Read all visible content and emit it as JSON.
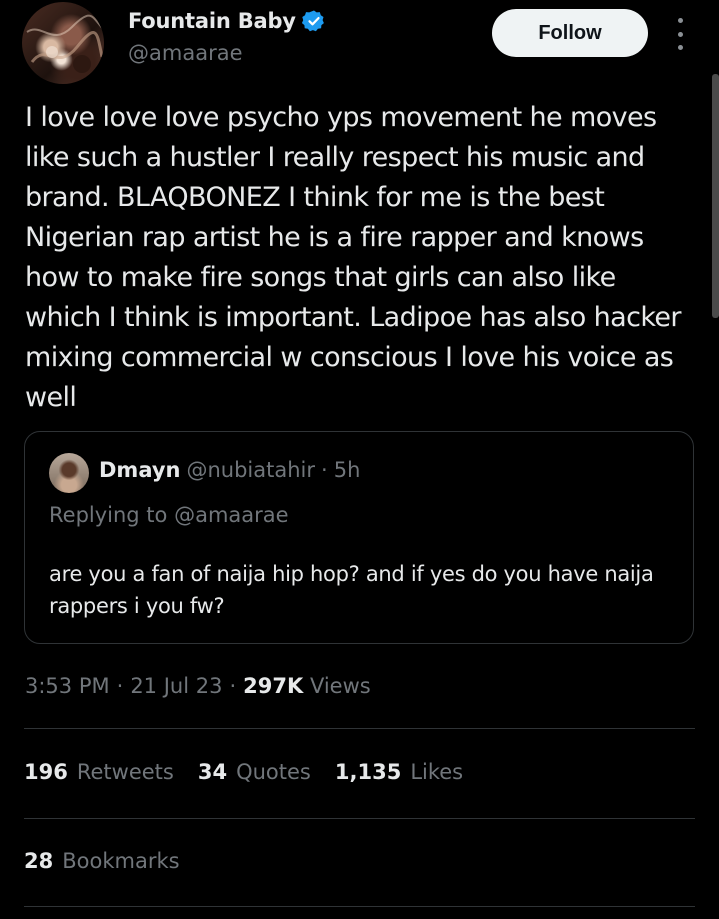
{
  "author": {
    "display_name": "Fountain Baby",
    "handle": "@amaarae",
    "verified": true
  },
  "follow_label": "Follow",
  "tweet_text": "I love love love psycho yps movement he moves like such a hustler I really respect his music and brand. BLAQBONEZ I think for me is the best Nigerian rap artist he is a fire rapper and knows how to make fire songs that girls can also like which I think is important. Ladipoe has also hacker mixing commercial w conscious I love his voice as well",
  "quoted": {
    "display_name": "Dmayn",
    "handle": "@nubiatahir",
    "separator": "·",
    "time": "5h",
    "reply_prefix": "Replying to",
    "reply_to": "@amaarae",
    "text": "are you a fan of naija hip hop? and if yes do you have naija rappers i you fw?"
  },
  "meta": {
    "time": "3:53 PM",
    "separator": "·",
    "date": "21 Jul 23",
    "views_count": "297K",
    "views_label": "Views"
  },
  "stats": {
    "retweets_count": "196",
    "retweets_label": "Retweets",
    "quotes_count": "34",
    "quotes_label": "Quotes",
    "likes_count": "1,135",
    "likes_label": "Likes",
    "bookmarks_count": "28",
    "bookmarks_label": "Bookmarks"
  },
  "colors": {
    "background": "#000000",
    "text_primary": "#e7e9ea",
    "text_secondary": "#71767b",
    "border": "#2f3336",
    "verified_blue": "#1d9bf0",
    "follow_bg": "#eff3f4"
  },
  "icons": [
    "verified-badge-icon",
    "more-options-icon"
  ]
}
